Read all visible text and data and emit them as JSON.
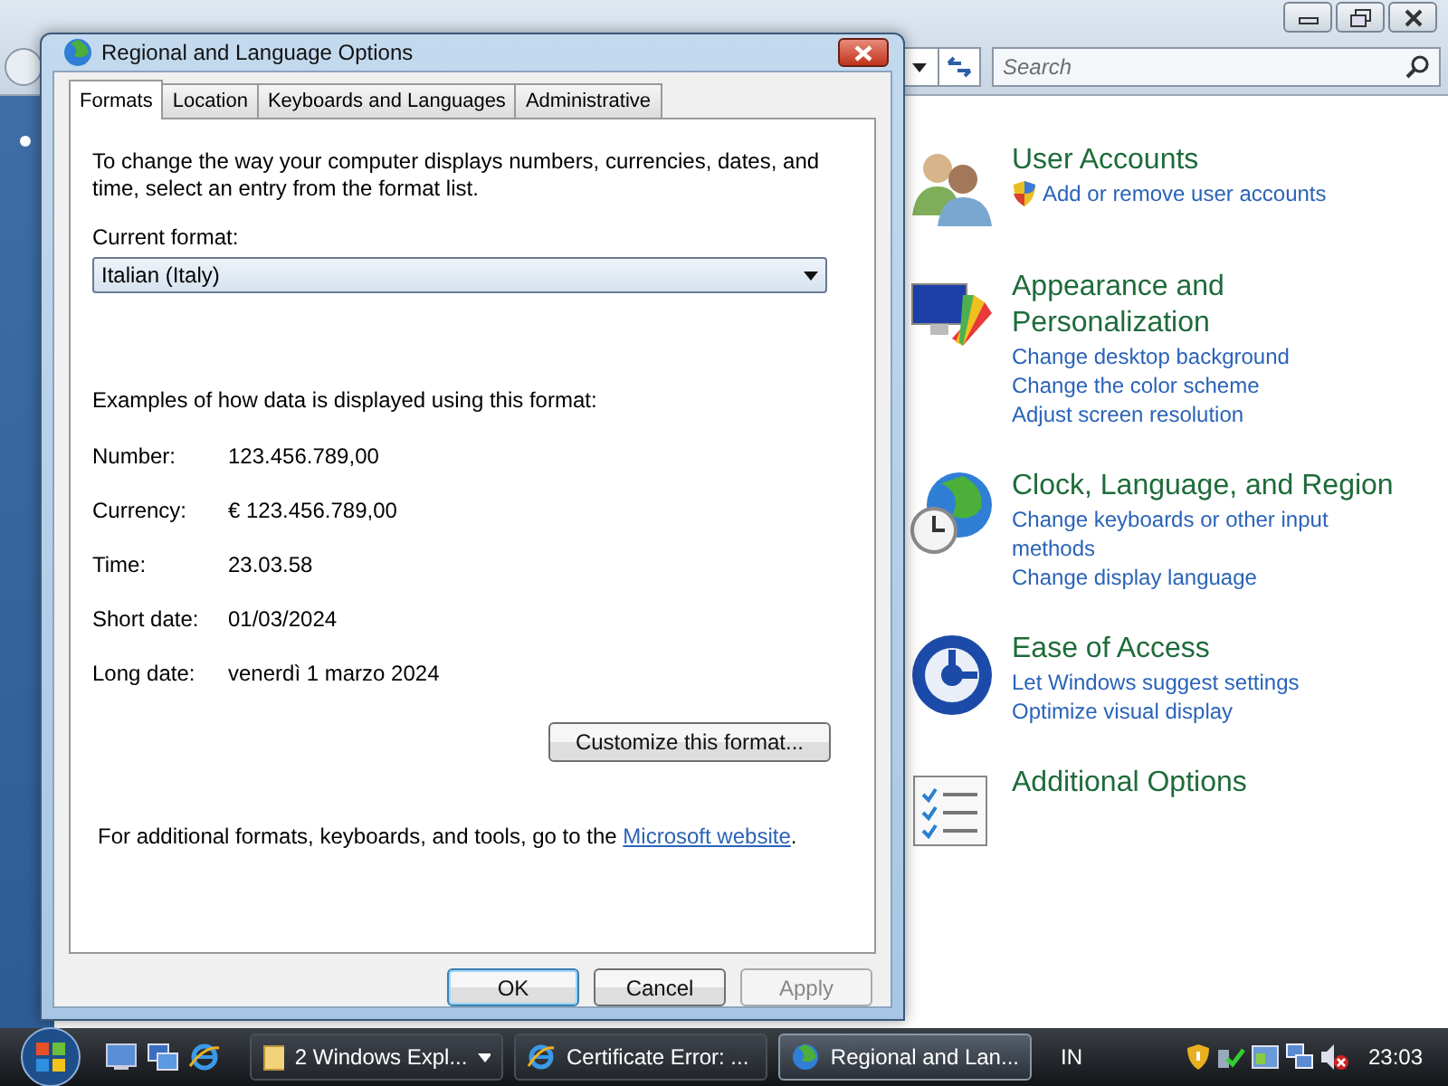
{
  "control_panel": {
    "search": {
      "placeholder": "Search"
    },
    "categories": [
      {
        "title": "User Accounts",
        "links": [
          {
            "text": "Add or remove user accounts",
            "kind": "shield"
          }
        ]
      },
      {
        "title": "Appearance and Personalization",
        "links": [
          {
            "text": "Change desktop background",
            "kind": "plain"
          },
          {
            "text": "Change the color scheme",
            "kind": "plain"
          },
          {
            "text": "Adjust screen resolution",
            "kind": "plain"
          }
        ]
      },
      {
        "title": "Clock, Language, and Region",
        "links": [
          {
            "text": "Change keyboards or other input methods",
            "kind": "plain"
          },
          {
            "text": "Change display language",
            "kind": "plain"
          }
        ]
      },
      {
        "title": "Ease of Access",
        "links": [
          {
            "text": "Let Windows suggest settings",
            "kind": "plain"
          },
          {
            "text": "Optimize visual display",
            "kind": "plain"
          }
        ]
      },
      {
        "title": "Additional Options"
      }
    ]
  },
  "dialog": {
    "title": "Regional and Language Options",
    "tabs": [
      {
        "label": "Formats",
        "selected": true
      },
      {
        "label": "Location",
        "selected": false
      },
      {
        "label": "Keyboards and Languages",
        "selected": false
      },
      {
        "label": "Administrative",
        "selected": false
      }
    ],
    "intro": "To change the way your computer displays numbers, currencies, dates, and time, select an entry from the format list.",
    "current_format_label": "Current format:",
    "current_format": "Italian (Italy)",
    "examples_heading": "Examples of how data is displayed using this format:",
    "examples": [
      {
        "label": "Number:",
        "value": "123.456.789,00"
      },
      {
        "label": "Currency:",
        "value": "€ 123.456.789,00"
      },
      {
        "label": "Time:",
        "value": "23.03.58"
      },
      {
        "label": "Short date:",
        "value": "01/03/2024"
      },
      {
        "label": "Long date:",
        "value": "venerdì 1 marzo 2024"
      }
    ],
    "customize_button": "Customize this format...",
    "footer": {
      "text": "For additional formats, keyboards, and tools, go to the",
      "link": "Microsoft website",
      "after": "."
    },
    "buttons": [
      {
        "label": "OK",
        "default": true,
        "disabled": false
      },
      {
        "label": "Cancel",
        "default": false,
        "disabled": false
      },
      {
        "label": "Apply",
        "default": false,
        "disabled": true
      }
    ]
  },
  "taskbar": {
    "tasks": [
      {
        "label": "2 Windows Expl...",
        "selected": false,
        "kind": "group"
      },
      {
        "label": "Certificate Error: ...",
        "selected": false,
        "kind": "browser"
      },
      {
        "label": "Regional and Lan...",
        "selected": true,
        "kind": "globe"
      }
    ],
    "language": "IN",
    "clock": "23:03"
  }
}
